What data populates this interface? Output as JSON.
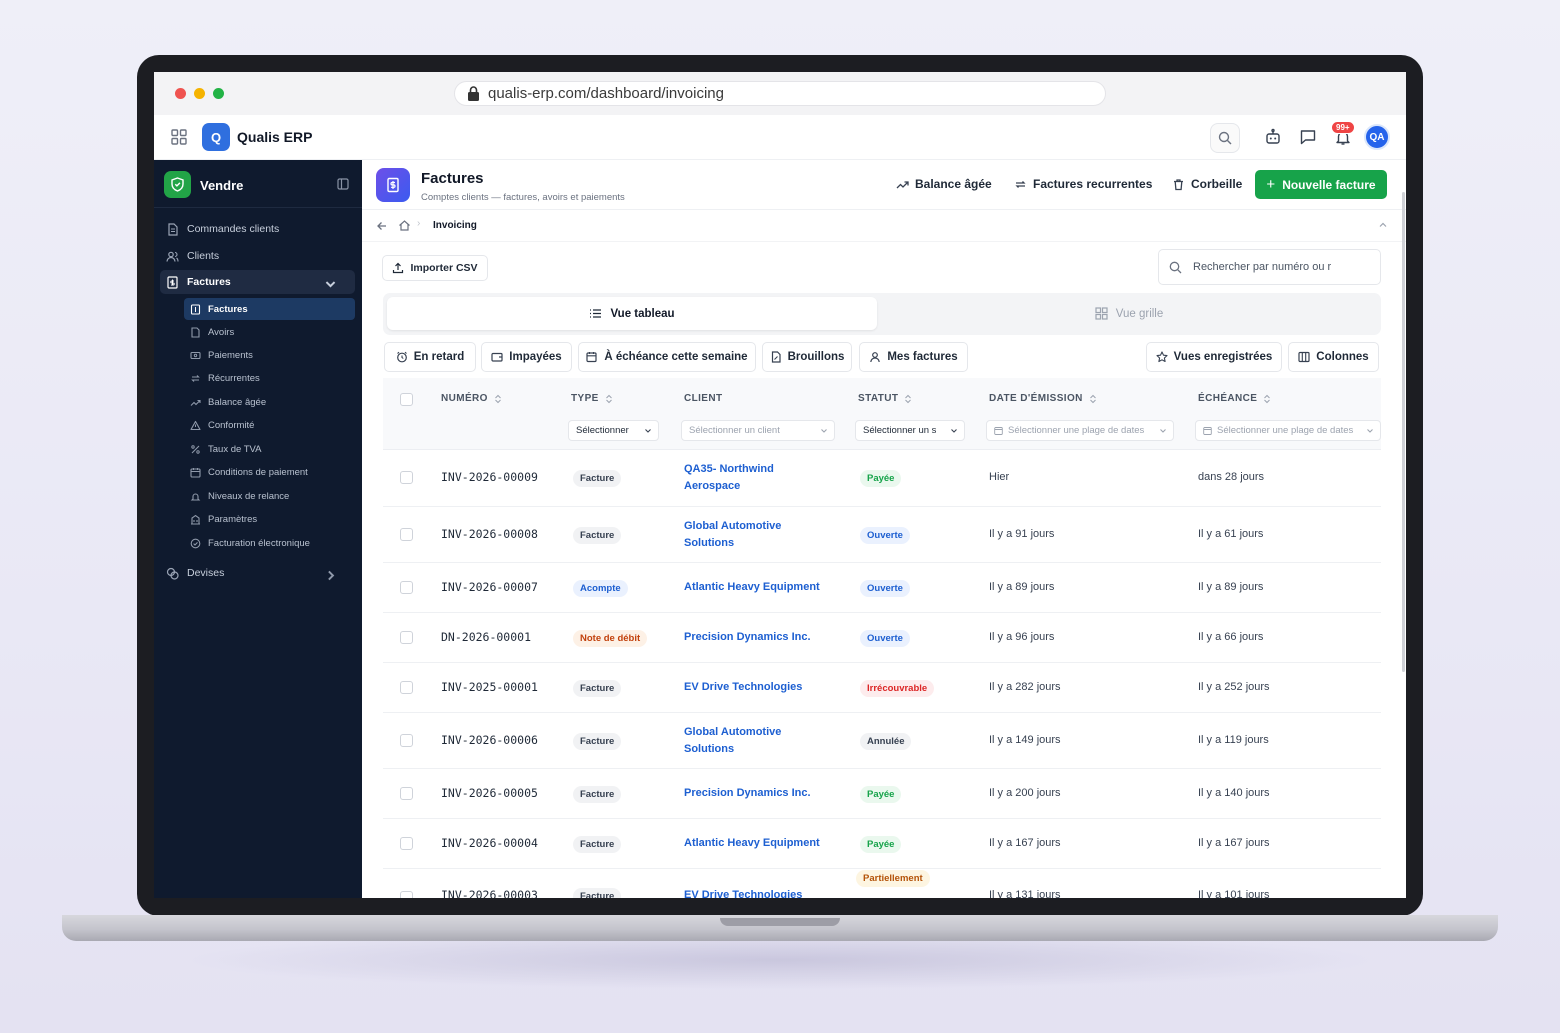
{
  "browser": {
    "url": "qualis-erp.com/dashboard/invoicing"
  },
  "topnav": {
    "logo_letter": "Q",
    "app_name": "Qualis ERP",
    "notif_badge": "99+",
    "avatar": "QA"
  },
  "sidebar": {
    "title": "Vendre",
    "items": [
      {
        "label": "Commandes clients"
      },
      {
        "label": "Clients"
      },
      {
        "label": "Factures"
      },
      {
        "label": "Devises"
      }
    ],
    "subitems": [
      {
        "label": "Factures"
      },
      {
        "label": "Avoirs"
      },
      {
        "label": "Paiements"
      },
      {
        "label": "Récurrentes"
      },
      {
        "label": "Balance âgée"
      },
      {
        "label": "Conformité"
      },
      {
        "label": "Taux de TVA"
      },
      {
        "label": "Conditions de paiement"
      },
      {
        "label": "Niveaux de relance"
      },
      {
        "label": "Paramètres"
      },
      {
        "label": "Facturation électronique"
      }
    ]
  },
  "header": {
    "title": "Factures",
    "subtitle": "Comptes clients — factures, avoirs et paiements",
    "aging": "Balance âgée",
    "recurring": "Factures recurrentes",
    "trash": "Corbeille",
    "new_invoice": "Nouvelle facture"
  },
  "breadcrumb": {
    "current": "Invoicing"
  },
  "toolbar": {
    "import": "Importer CSV",
    "search_placeholder": "Rechercher par numéro ou r"
  },
  "views": {
    "table": "Vue tableau",
    "grid": "Vue grille"
  },
  "chips": {
    "late": "En retard",
    "unpaid": "Impayées",
    "due_week": "À échéance cette semaine",
    "drafts": "Brouillons",
    "mine": "Mes factures",
    "saved_views": "Vues enregistrées",
    "columns": "Colonnes"
  },
  "table": {
    "headers": {
      "number": "NUMÉRO",
      "type": "TYPE",
      "client": "CLIENT",
      "status": "STATUT",
      "issue_date": "DATE D'ÉMISSION",
      "due": "ÉCHÉANCE"
    },
    "filters": {
      "type": "Sélectionner",
      "client": "Sélectionner un client",
      "status": "Sélectionner un s",
      "issue_date": "Sélectionner une plage de dates",
      "due": "Sélectionner une plage de dates"
    },
    "rows": [
      {
        "number": "INV-2026-00009",
        "type": "Facture",
        "client": "QA35- Northwind Aerospace",
        "status": "Payée",
        "issued": "Hier",
        "due": "dans 28 jours"
      },
      {
        "number": "INV-2026-00008",
        "type": "Facture",
        "client": "Global Automotive Solutions",
        "status": "Ouverte",
        "issued": "Il y a 91 jours",
        "due": "Il y a 61 jours"
      },
      {
        "number": "INV-2026-00007",
        "type": "Acompte",
        "client": "Atlantic Heavy Equipment",
        "status": "Ouverte",
        "issued": "Il y a 89 jours",
        "due": "Il y a 89 jours"
      },
      {
        "number": "DN-2026-00001",
        "type": "Note de débit",
        "client": "Precision Dynamics Inc.",
        "status": "Ouverte",
        "issued": "Il y a 96 jours",
        "due": "Il y a 66 jours"
      },
      {
        "number": "INV-2025-00001",
        "type": "Facture",
        "client": "EV Drive Technologies",
        "status": "Irrécouvrable",
        "issued": "Il y a 282 jours",
        "due": "Il y a 252 jours"
      },
      {
        "number": "INV-2026-00006",
        "type": "Facture",
        "client": "Global Automotive Solutions",
        "status": "Annulée",
        "issued": "Il y a 149 jours",
        "due": "Il y a 119 jours"
      },
      {
        "number": "INV-2026-00005",
        "type": "Facture",
        "client": "Precision Dynamics Inc.",
        "status": "Payée",
        "issued": "Il y a 200 jours",
        "due": "Il y a 140 jours"
      },
      {
        "number": "INV-2026-00004",
        "type": "Facture",
        "client": "Atlantic Heavy Equipment",
        "status": "Payée",
        "issued": "Il y a 167 jours",
        "due": "Il y a 167 jours"
      },
      {
        "number": "INV-2026-00003",
        "type": "Facture",
        "client": "EV Drive Technologies",
        "status": "Partiellement",
        "issued": "Il y a 131 jours",
        "due": "Il y a 101 jours"
      }
    ]
  },
  "colors": {
    "accent": "#17a34a",
    "brand": "#2f6fdf",
    "sidebar_bg": "#0f1a2e",
    "link": "#1d5fd1"
  }
}
